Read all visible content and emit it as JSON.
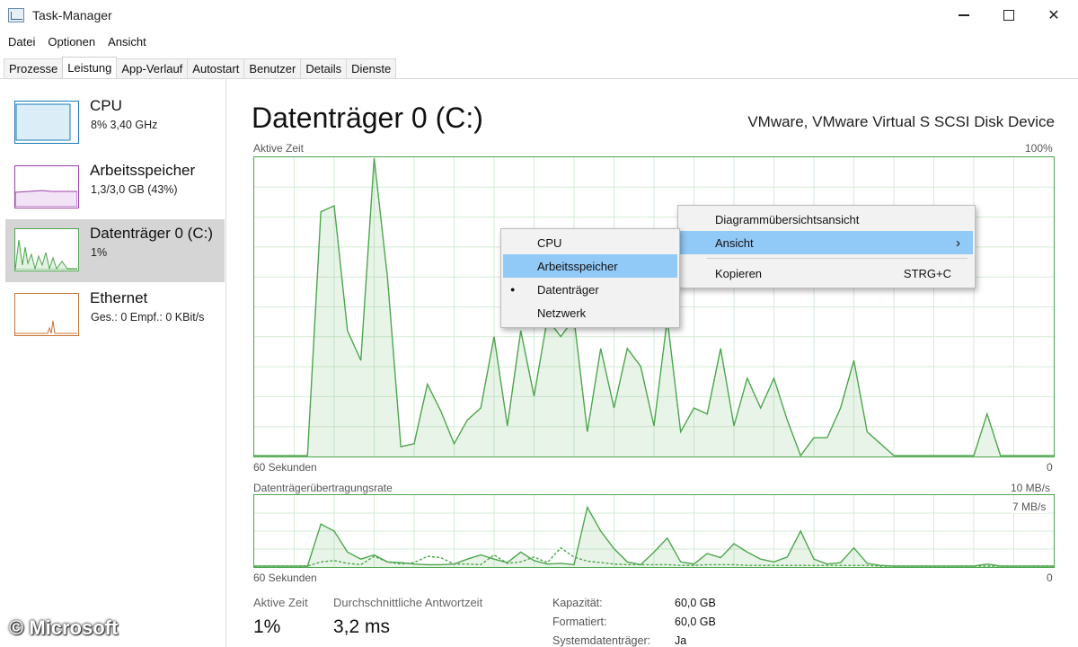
{
  "window": {
    "title": "Task-Manager"
  },
  "menu": [
    "Datei",
    "Optionen",
    "Ansicht"
  ],
  "tabs": [
    "Prozesse",
    "Leistung",
    "App-Verlauf",
    "Autostart",
    "Benutzer",
    "Details",
    "Dienste"
  ],
  "active_tab": "Leistung",
  "sidebar": {
    "items": [
      {
        "title": "CPU",
        "sub": "8% 3,40 GHz",
        "color": "#1a7ab8"
      },
      {
        "title": "Arbeitsspeicher",
        "sub": "1,3/3,0 GB (43%)",
        "color": "#9b3fa8"
      },
      {
        "title": "Datenträger 0 (C:)",
        "sub": "1%",
        "color": "#4da64d"
      },
      {
        "title": "Ethernet",
        "sub": "Ges.: 0 Empf.: 0 KBit/s",
        "color": "#c87533"
      }
    ],
    "selected": "Datenträger 0 (C:)"
  },
  "main": {
    "title": "Datenträger 0 (C:)",
    "device": "VMware, VMware Virtual S SCSI Disk Device",
    "chart1": {
      "label": "Aktive Zeit",
      "max": "100%",
      "time": "60 Sekunden",
      "min": "0"
    },
    "chart2": {
      "label": "Datenträgerübertragungsrate",
      "max": "10 MB/s",
      "secondary": "7 MB/s",
      "time": "60 Sekunden",
      "min": "0"
    },
    "stats": {
      "active_label": "Aktive Zeit",
      "active_value": "1%",
      "resp_label": "Durchschnittliche Antwortzeit",
      "resp_value": "3,2 ms"
    },
    "props": [
      {
        "label": "Kapazität:",
        "value": "60,0 GB"
      },
      {
        "label": "Formatiert:",
        "value": "60,0 GB"
      },
      {
        "label": "Systemdatenträger:",
        "value": "Ja"
      }
    ]
  },
  "chart_data": [
    {
      "type": "area",
      "title": "Aktive Zeit",
      "x_label": "60 Sekunden",
      "ylim": [
        0,
        100
      ],
      "values": [
        0,
        0,
        0,
        0,
        0,
        82,
        84,
        42,
        32,
        100,
        60,
        3,
        4,
        24,
        15,
        4,
        12,
        16,
        40,
        10,
        42,
        20,
        46,
        40,
        46,
        8,
        36,
        16,
        36,
        30,
        10,
        46,
        8,
        16,
        14,
        36,
        10,
        26,
        16,
        26,
        12,
        0,
        6,
        6,
        16,
        32,
        8,
        4,
        0,
        0,
        0,
        0,
        0,
        0,
        0,
        14,
        0,
        0,
        0,
        0,
        0
      ],
      "color": "#4da64d"
    },
    {
      "type": "area",
      "title": "Datenträgerübertragungsrate",
      "x_label": "60 Sekunden",
      "ylim": [
        0,
        10
      ],
      "series": [
        {
          "values": [
            0,
            0,
            0,
            0,
            0,
            6,
            5,
            2,
            1,
            1.6,
            0.6,
            0.5,
            0.3,
            0.2,
            0.2,
            0.3,
            1,
            1.6,
            1,
            0.5,
            2,
            0.8,
            0.3,
            0.4,
            0.2,
            8.4,
            5,
            2.5,
            0.6,
            0.2,
            2,
            4,
            0.6,
            0.3,
            1.8,
            1.2,
            3.2,
            2,
            1,
            0.6,
            1.3,
            5,
            1,
            0.3,
            0.5,
            2.6,
            0.4,
            0.1,
            0,
            0,
            0,
            0,
            0,
            0,
            0,
            0.3,
            0,
            0,
            0,
            0,
            0
          ]
        },
        {
          "values": [
            0,
            0,
            0,
            0,
            0,
            0.6,
            0.8,
            0.4,
            0.2,
            1.4,
            0.6,
            0.3,
            0.5,
            1.4,
            1.2,
            0.3,
            0.3,
            0.2,
            1.6,
            0.4,
            0.6,
            1.3,
            0.5,
            2.6,
            1.3,
            0.7,
            0.5,
            0.3,
            0.2,
            0.2,
            0.2,
            0.2,
            0.1,
            0.1,
            0.2,
            0.2,
            0.2,
            0.1,
            0.1,
            0.1,
            0.1,
            0.1,
            0.1,
            0.1,
            0.1,
            0.1,
            0.1,
            0,
            0,
            0,
            0,
            0,
            0,
            0,
            0,
            0,
            0,
            0,
            0,
            0,
            0
          ]
        }
      ],
      "color": "#4da64d"
    }
  ],
  "context_menus": {
    "chart_menu": {
      "items": [
        "Diagrammübersichtsansicht",
        "Ansicht",
        "Kopieren"
      ],
      "shortcut": "STRG+C",
      "submenu_arrow": "›",
      "highlighted": "Ansicht"
    },
    "view_submenu": {
      "items": [
        "CPU",
        "Arbeitsspeicher",
        "Datenträger",
        "Netzwerk"
      ],
      "highlighted": "Arbeitsspeicher",
      "checked": "Datenträger",
      "bullet": "●"
    }
  },
  "watermark": "© Microsoft"
}
